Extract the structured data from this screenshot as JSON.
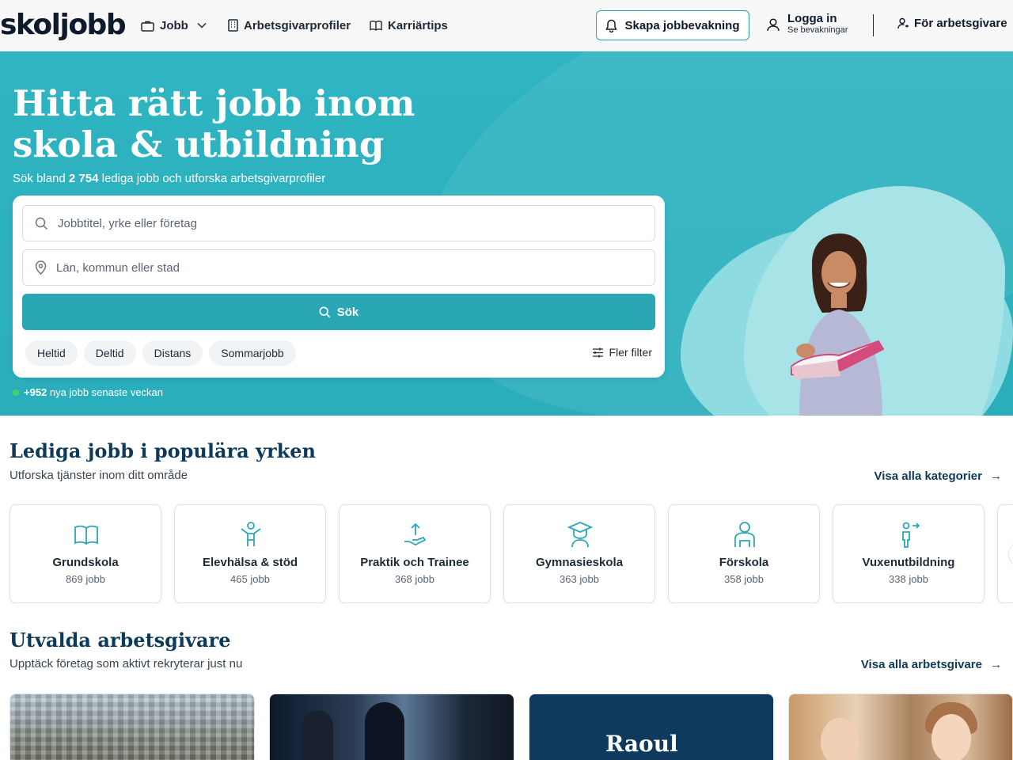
{
  "header": {
    "logo": "skoljobb",
    "nav": {
      "jobs": "Jobb",
      "employer_profiles": "Arbetsgivarprofiler",
      "career_tips": "Karriärtips"
    },
    "create_alert": "Skapa jobbevakning",
    "login_title": "Logga in",
    "login_sub": "Se bevakningar",
    "for_employers": "För arbetsgivare"
  },
  "hero": {
    "title": "Hitta rätt jobb inom skola & utbildning",
    "subtitle_pre": "Sök bland ",
    "job_count": "2 754",
    "subtitle_post": " lediga jobb och utforska arbetsgivarprofiler",
    "search": {
      "keyword_placeholder": "Jobbtitel, yrke eller företag",
      "location_placeholder": "Län, kommun eller stad",
      "button": "Sök"
    },
    "chips": [
      "Heltid",
      "Deltid",
      "Distans",
      "Sommarjobb"
    ],
    "more_filters": "Fler filter",
    "new_jobs_count": "+952",
    "new_jobs_text": " nya jobb senaste veckan"
  },
  "categories": {
    "title": "Lediga jobb i populära yrken",
    "subtitle": "Utforska tjänster inom ditt område",
    "view_all": "Visa alla kategorier",
    "items": [
      {
        "name": "Grundskola",
        "count": "869 jobb",
        "icon": "book-icon"
      },
      {
        "name": "Elevhälsa & stöd",
        "count": "465 jobb",
        "icon": "person-support-icon"
      },
      {
        "name": "Praktik och Trainee",
        "count": "368 jobb",
        "icon": "hand-growth-icon"
      },
      {
        "name": "Gymnasieskola",
        "count": "363 jobb",
        "icon": "graduate-icon"
      },
      {
        "name": "Förskola",
        "count": "358 jobb",
        "icon": "child-icon"
      },
      {
        "name": "Vuxenutbildning",
        "count": "338 jobb",
        "icon": "adult-learner-icon"
      }
    ]
  },
  "employers": {
    "title": "Utvalda arbetsgivare",
    "subtitle": "Upptäck företag som aktivt rekryterar just nu",
    "view_all": "Visa alla arbetsgivare",
    "featured_logo_text": "Raoul"
  },
  "colors": {
    "brand_teal": "#2aa7b5",
    "hero_bg": "#2fb4c2",
    "heading_navy": "#0e3a5a",
    "new_jobs_dot": "#3fd46a"
  }
}
